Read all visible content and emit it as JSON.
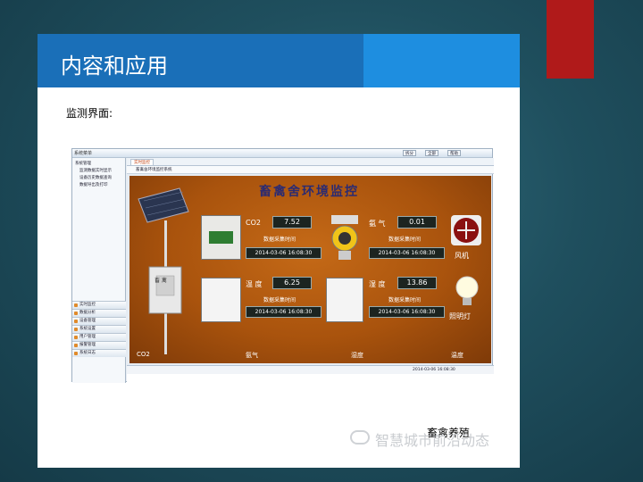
{
  "slide": {
    "title": "内容和应用",
    "caption": "监测界面:"
  },
  "app": {
    "sys_label": "系统菜单",
    "top_buttons": [
      "拆分",
      "全部",
      "帮助"
    ],
    "sidebar": {
      "tree": [
        "系统管理",
        "监测数据实时显示",
        "设备历史数据查询",
        "数据导出及打印"
      ],
      "nav": [
        "实时监控",
        "数据分析",
        "设备管理",
        "系统设置",
        "用户管理",
        "报警管理",
        "系统日志"
      ]
    },
    "tab_label": "实时监控",
    "crumb": "畜禽舍环境监控系统"
  },
  "monitor": {
    "title": "畜禽舍环境监控",
    "co2_label": "CO2",
    "co2_value": "7.52",
    "co2_time_label": "数据采集时间",
    "co2_time": "2014-03-06 16:08:30",
    "nh3_label": "氨 气",
    "nh3_value": "0.01",
    "nh3_time_label": "数据采集时间",
    "nh3_time": "2014-03-06 16:08:30",
    "temp_label": "温 度",
    "temp_value": "6.25",
    "temp_time_label": "数据采集时间",
    "temp_time": "2014-03-06 16:08:30",
    "hum_label": "湿 度",
    "hum_value": "13.86",
    "hum_time_label": "数据采集时间",
    "hum_time": "2014-03-06 16:08:30",
    "fan_label": "风机",
    "light_label": "照明灯",
    "bottom_labels": [
      "CO2",
      "氨气",
      "湿度",
      "温度"
    ],
    "sensor_tag": "畜 禽"
  },
  "status": "2014-03-06 16:08:30",
  "watermark": {
    "text": "智慧城市前沿动态",
    "overlay": "畜禽养殖"
  },
  "colors": {
    "accent_red": "#b01a1a",
    "title_bar": "#1a6fb8",
    "monitor_bg": "#b35c10"
  }
}
